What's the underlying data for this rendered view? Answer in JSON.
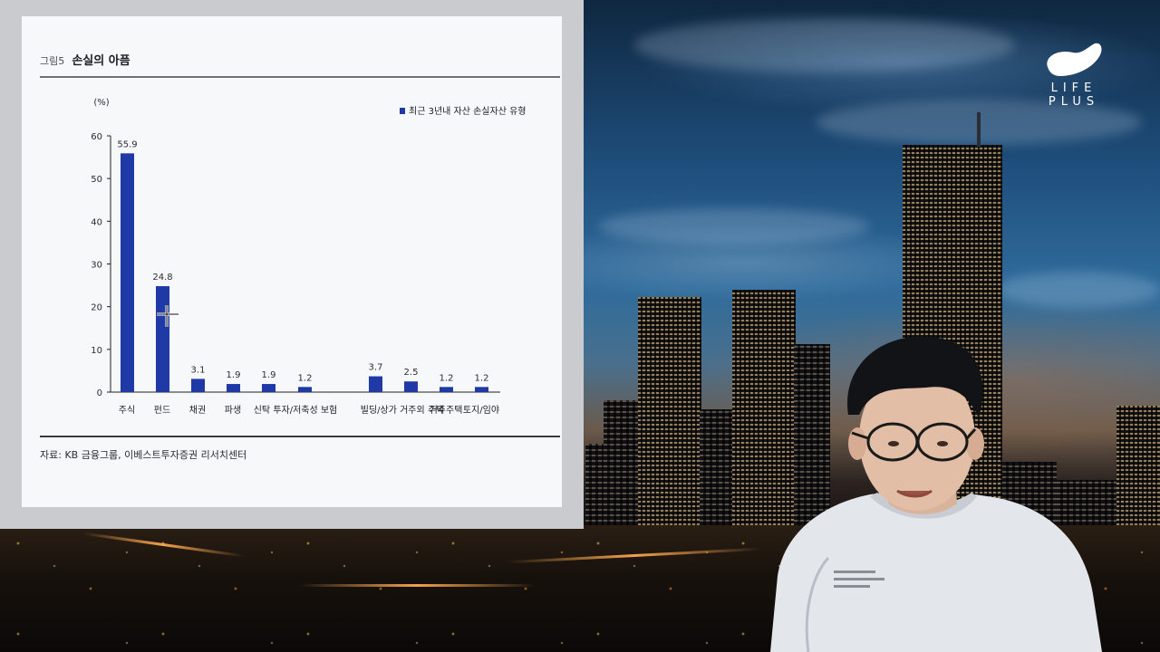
{
  "slide": {
    "figure_number": "그림5",
    "figure_title": "손실의 아픔",
    "source": "자료: KB 금융그룹, 이베스트투자증권 리서치센터"
  },
  "logo": {
    "line1": "LIFE",
    "line2": "PLUS"
  },
  "colors": {
    "bar": "#1f3aa6",
    "axis": "#222222",
    "slide_bg": "#f7f8fa"
  },
  "chart_data": {
    "type": "bar",
    "title": "손실의 아픔",
    "ylabel": "(%)",
    "ylim": [
      0,
      60
    ],
    "yticks": [
      0,
      10,
      20,
      30,
      40,
      50,
      60
    ],
    "legend": {
      "label": "최근 3년내 자산 손실자산 유형",
      "position": "top-right"
    },
    "series": [
      {
        "name": "최근 3년내 자산 손실자산 유형",
        "values": [
          55.9,
          24.8,
          3.1,
          1.9,
          1.9,
          1.2,
          3.7,
          2.5,
          1.2,
          1.2
        ]
      }
    ],
    "categories": [
      "주식",
      "펀드",
      "채권",
      "파생",
      "신탁 투자/저축성 보험",
      "빌딩/상가",
      "거주외 주택",
      "거주주택",
      "토지/임야"
    ],
    "bars": [
      {
        "category": "주식",
        "value": 55.9,
        "label": "55.9"
      },
      {
        "category": "펀드",
        "value": 24.8,
        "label": "24.8"
      },
      {
        "category": "채권",
        "value": 3.1,
        "label": "3.1"
      },
      {
        "category": "파생",
        "value": 1.9,
        "label": "1.9"
      },
      {
        "category": "신탁 투자",
        "value": 1.9,
        "label": "1.9"
      },
      {
        "category": "저축성 보험",
        "value": 1.2,
        "label": "1.2"
      },
      {
        "category": "빌딩/상가",
        "value": 3.7,
        "label": "3.7"
      },
      {
        "category": "거주외 주택",
        "value": 2.5,
        "label": "2.5"
      },
      {
        "category": "거주주택",
        "value": 1.2,
        "label": "1.2"
      },
      {
        "category": "토지/임야",
        "value": 1.2,
        "label": "1.2"
      }
    ],
    "x_tick_labels": [
      "주식",
      "펀드",
      "채권",
      "파생",
      "신탁 투자/저축성 보험",
      "빌딩/상가 거주외 주택",
      "거주주택",
      "토지/임야"
    ],
    "grid": false
  }
}
